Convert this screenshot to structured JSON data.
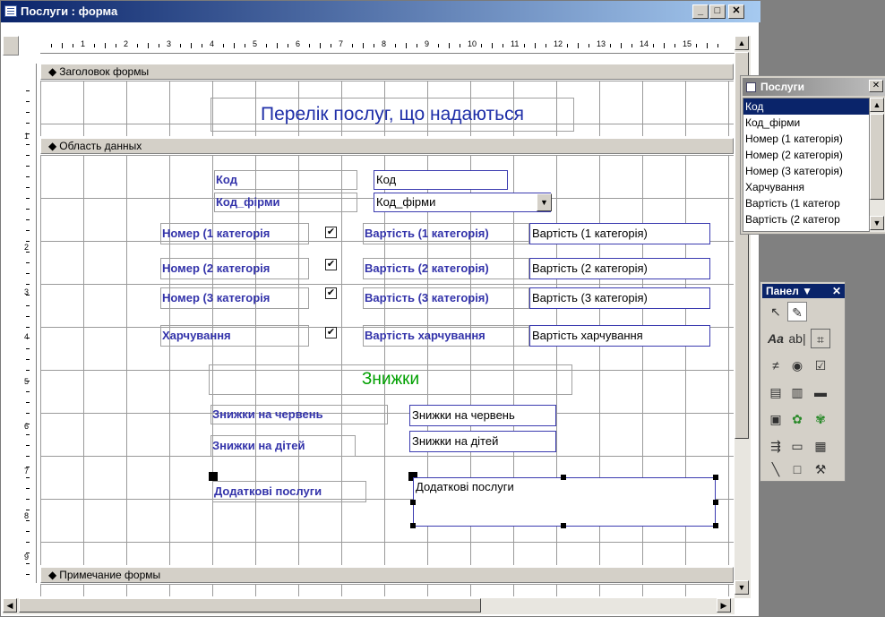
{
  "window": {
    "title": "Послуги : форма",
    "min": "_",
    "max": "□",
    "close": "✕"
  },
  "ruler": {
    "numbers": [
      "1",
      "2",
      "3",
      "4",
      "5",
      "6",
      "7",
      "8",
      "9",
      "10",
      "11",
      "12",
      "13",
      "14",
      "15"
    ],
    "vnumbers": [
      "1",
      "2",
      "3",
      "4",
      "5",
      "6",
      "7",
      "8",
      "9"
    ]
  },
  "sections": {
    "header": "Заголовок формы",
    "detail": "Область данных",
    "footer": "Примечание формы"
  },
  "form_title": "Перелік послуг, що надаються",
  "fields": {
    "kod_label": "Код",
    "kod_value": "Код",
    "kodf_label": "Код_фірми",
    "kodf_value": "Код_фірми",
    "n1_label": "Номер (1 категорія",
    "n2_label": "Номер (2 категорія",
    "n3_label": "Номер (3 категорія",
    "meal_label": "Харчування",
    "v1_label": "Вартість (1 категорія)",
    "v1_value": "Вартість (1 категорія)",
    "v2_label": "Вартість (2 категорія)",
    "v2_value": "Вартість (2 категорія)",
    "v3_label": "Вартість (3 категорія)",
    "v3_value": "Вартість (3 категорія)",
    "vm_label": "Вартість харчування",
    "vm_value": "Вартість харчування",
    "checkmark": "✔",
    "discounts_title": "Знижки",
    "june_label": "Знижки на червень",
    "june_value": "Знижки на червень",
    "kids_label": "Знижки на дітей",
    "kids_value": "Знижки на дітей",
    "extra_label": "Додаткові послуги",
    "extra_value": "Додаткові послуги"
  },
  "field_list": {
    "title": "Послуги",
    "items": [
      "Код",
      "Код_фірми",
      "Номер (1 категорія)",
      "Номер (2 категорія)",
      "Номер (3 категорія)",
      "Харчування",
      "Вартість (1 категор",
      "Вартість (2 категор"
    ],
    "selected": "Код"
  },
  "toolbox": {
    "title": "Панел ▼",
    "close": "✕"
  },
  "colors": {
    "title_active": "#0a246a",
    "label_text": "#3333aa",
    "discount_title": "#00a000",
    "form_title": "#1f2fa8"
  }
}
